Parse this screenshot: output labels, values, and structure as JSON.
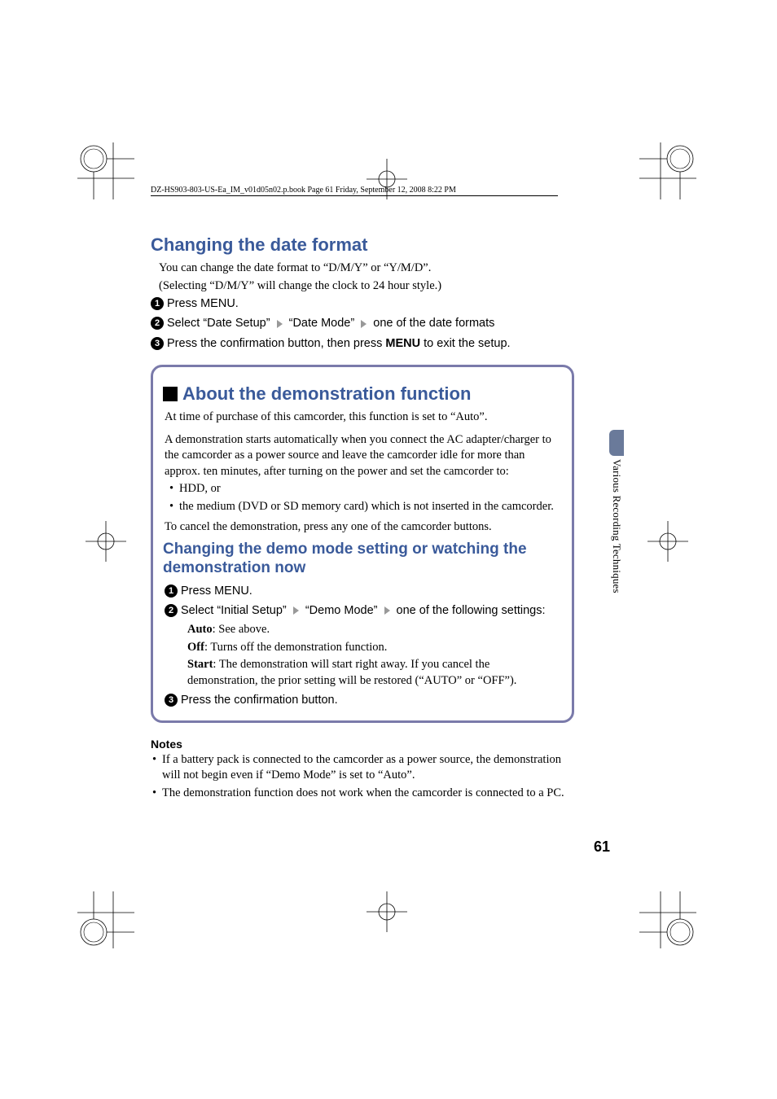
{
  "header": {
    "running": "DZ-HS903-803-US-Ea_IM_v01d05n02.p.book  Page 61  Friday, September 12, 2008  8:22 PM"
  },
  "section1": {
    "title": "Changing the date format",
    "p1": "You can change the date format to “D/M/Y” or “Y/M/D”.",
    "p2": "(Selecting “D/M/Y” will change the clock to 24 hour style.)",
    "step1": "Press MENU.",
    "step2a": "Select “Date Setup”",
    "step2b": "“Date Mode”",
    "step2c": "one of the date formats",
    "step3a": "Press the confirmation button, then press ",
    "step3b": "MENU",
    "step3c": " to exit the setup."
  },
  "box": {
    "title": "About the demonstration function",
    "p1": "At time of purchase of this camcorder, this function is set to “Auto”.",
    "p2": "A demonstration starts automatically when you connect the AC adapter/charger to the camcorder as a power source and leave the camcorder idle for more than approx. ten minutes, after turning on the power and set the camcorder to:",
    "b1": "HDD, or",
    "b2": "the medium (DVD or SD memory card) which is not inserted in the camcorder.",
    "p3": "To cancel the demonstration, press any one of the camcorder buttons.",
    "h2": "Changing the demo mode setting or watching the demonstration now",
    "step1": "Press MENU.",
    "step2a": "Select “Initial Setup”",
    "step2b": "“Demo Mode”",
    "step2c": "one of the following settings:",
    "opt1a": "Auto",
    "opt1b": ": See above.",
    "opt2a": "Off",
    "opt2b": ": Turns off the demonstration function.",
    "opt3a": "Start",
    "opt3b": ": The demonstration will start right away. If you cancel the demonstration, the prior setting will be restored (“AUTO” or “OFF”).",
    "step3": "Press the confirmation button."
  },
  "notes": {
    "title": "Notes",
    "n1": "If a battery pack is connected to the camcorder as a power source, the demonstration will not begin even if “Demo Mode” is set to “Auto”.",
    "n2": "The demonstration function does not work when the camcorder is connected to a PC."
  },
  "side": {
    "label": "Various Recording Techniques"
  },
  "page_number": "61"
}
